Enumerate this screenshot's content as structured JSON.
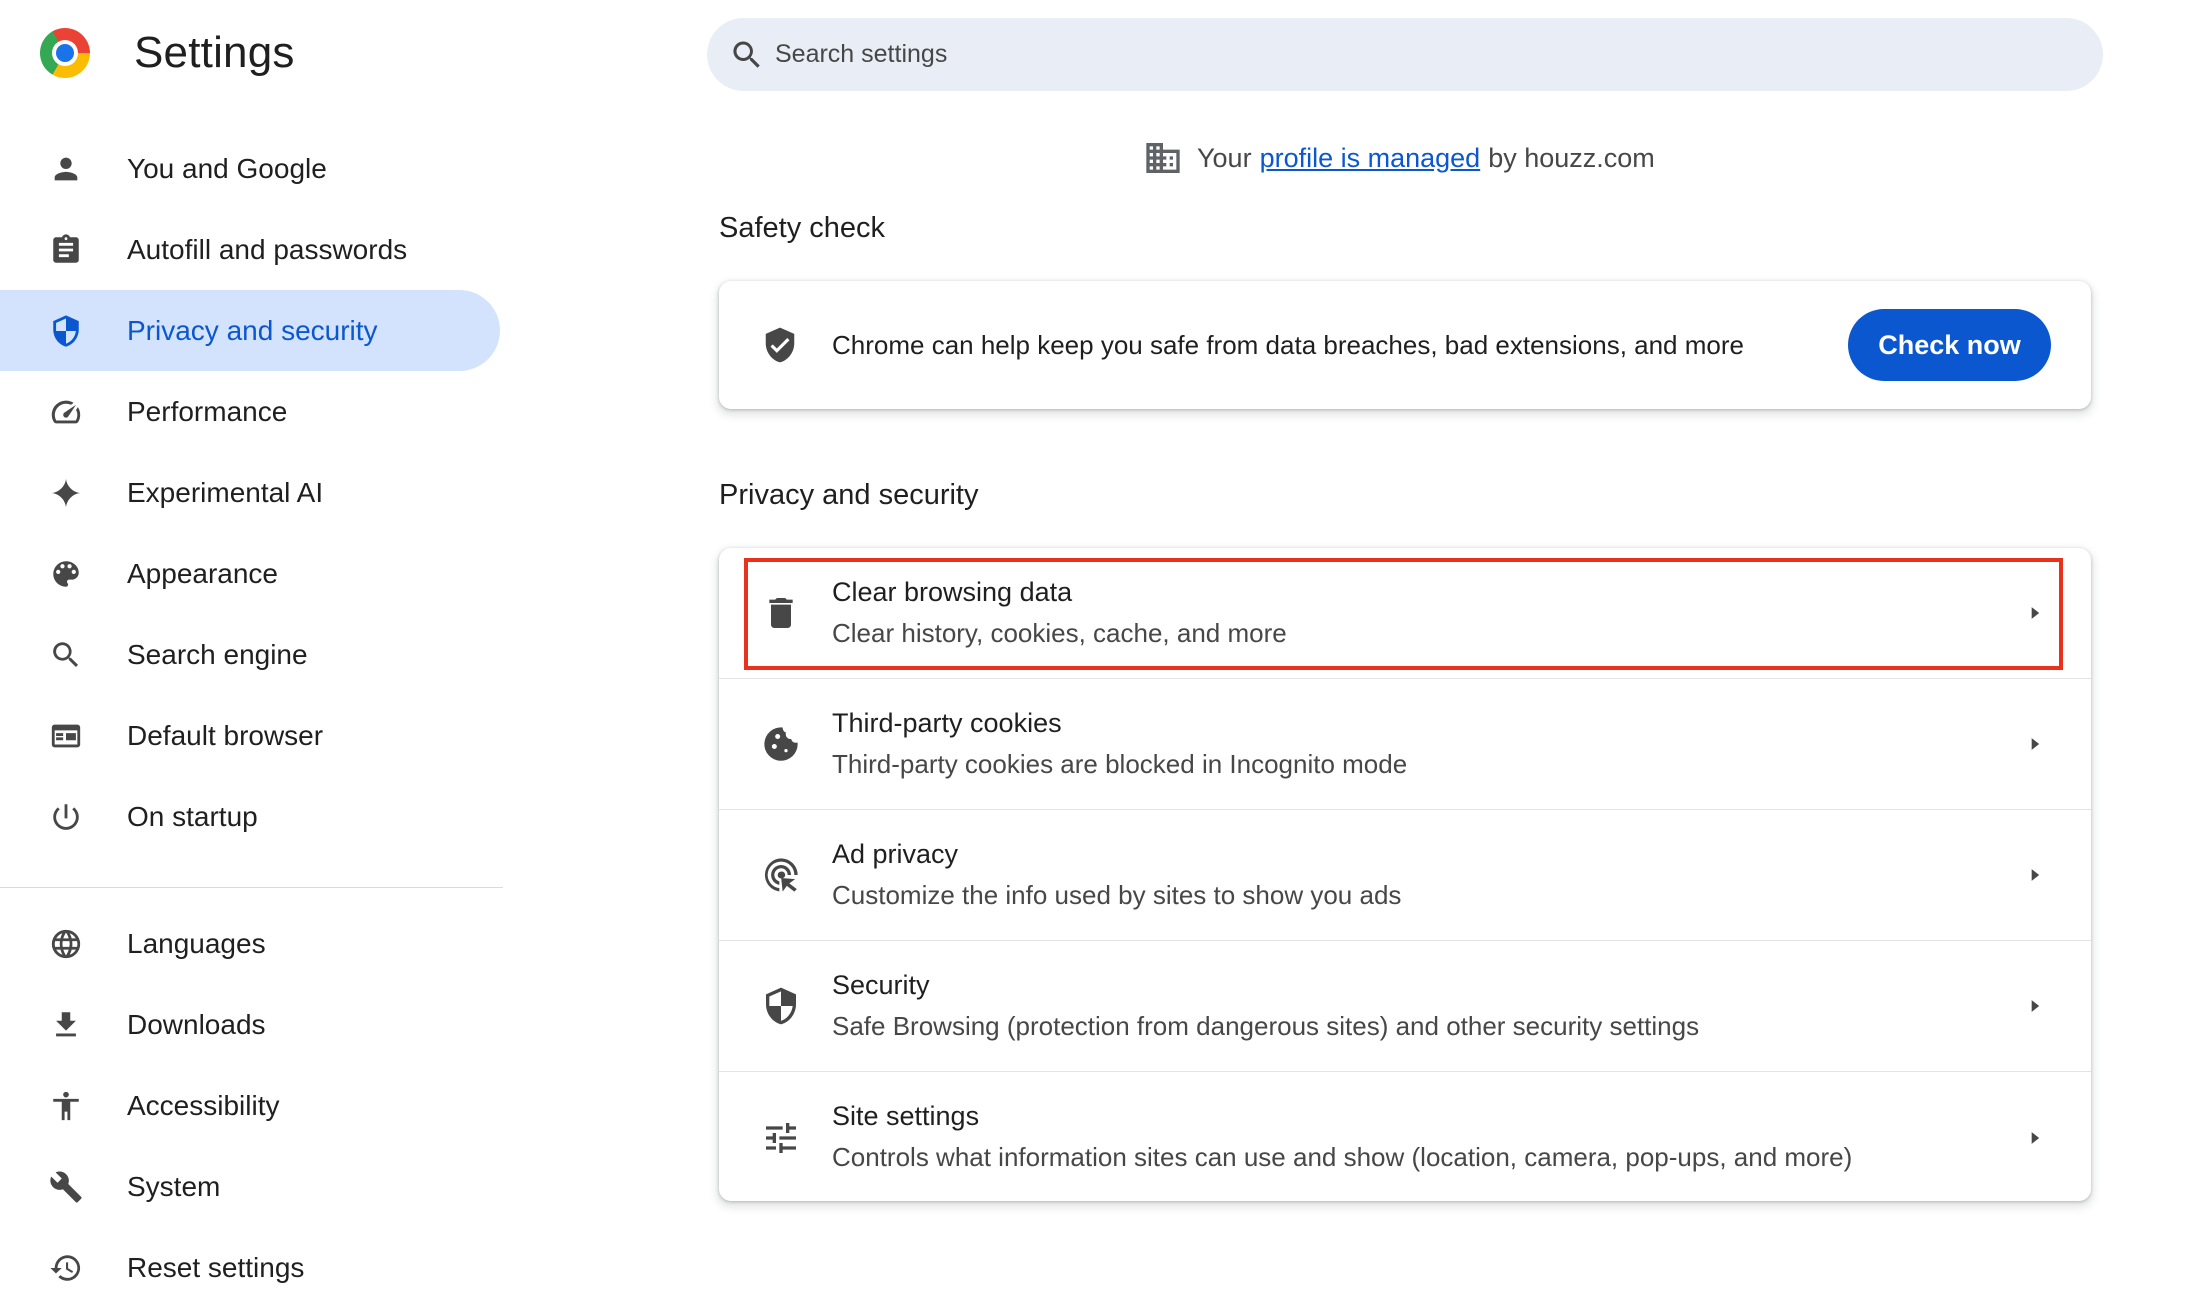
{
  "app": {
    "title": "Settings"
  },
  "sidebar": {
    "items": [
      {
        "label": "You and Google",
        "icon": "person-icon"
      },
      {
        "label": "Autofill and passwords",
        "icon": "clipboard-icon"
      },
      {
        "label": "Privacy and security",
        "icon": "shield-icon",
        "active": true
      },
      {
        "label": "Performance",
        "icon": "speedometer-icon"
      },
      {
        "label": "Experimental AI",
        "icon": "sparkle-icon"
      },
      {
        "label": "Appearance",
        "icon": "palette-icon"
      },
      {
        "label": "Search engine",
        "icon": "search-icon"
      },
      {
        "label": "Default browser",
        "icon": "browser-icon"
      },
      {
        "label": "On startup",
        "icon": "power-icon"
      },
      {
        "label": "Languages",
        "icon": "globe-icon"
      },
      {
        "label": "Downloads",
        "icon": "download-icon"
      },
      {
        "label": "Accessibility",
        "icon": "accessibility-icon"
      },
      {
        "label": "System",
        "icon": "wrench-icon"
      },
      {
        "label": "Reset settings",
        "icon": "history-icon"
      }
    ]
  },
  "search": {
    "placeholder": "Search settings"
  },
  "managed": {
    "prefix": "Your",
    "link": "profile is managed",
    "suffix": "by houzz.com"
  },
  "safety_check": {
    "title": "Safety check",
    "text": "Chrome can help keep you safe from data breaches, bad extensions, and more",
    "button": "Check now"
  },
  "privacy": {
    "title": "Privacy and security",
    "rows": [
      {
        "title": "Clear browsing data",
        "subtitle": "Clear history, cookies, cache, and more",
        "icon": "trash-icon",
        "highlighted": true
      },
      {
        "title": "Third-party cookies",
        "subtitle": "Third-party cookies are blocked in Incognito mode",
        "icon": "cookie-icon"
      },
      {
        "title": "Ad privacy",
        "subtitle": "Customize the info used by sites to show you ads",
        "icon": "ad-privacy-icon"
      },
      {
        "title": "Security",
        "subtitle": "Safe Browsing (protection from dangerous sites) and other security settings",
        "icon": "shield-icon"
      },
      {
        "title": "Site settings",
        "subtitle": "Controls what information sites can use and show (location, camera, pop-ups, and more)",
        "icon": "sliders-icon"
      }
    ]
  },
  "colors": {
    "accent": "#0b57d0",
    "active_bg": "#d3e3fd",
    "search_bg": "#e9eef6",
    "highlight_border": "#e8321c"
  }
}
